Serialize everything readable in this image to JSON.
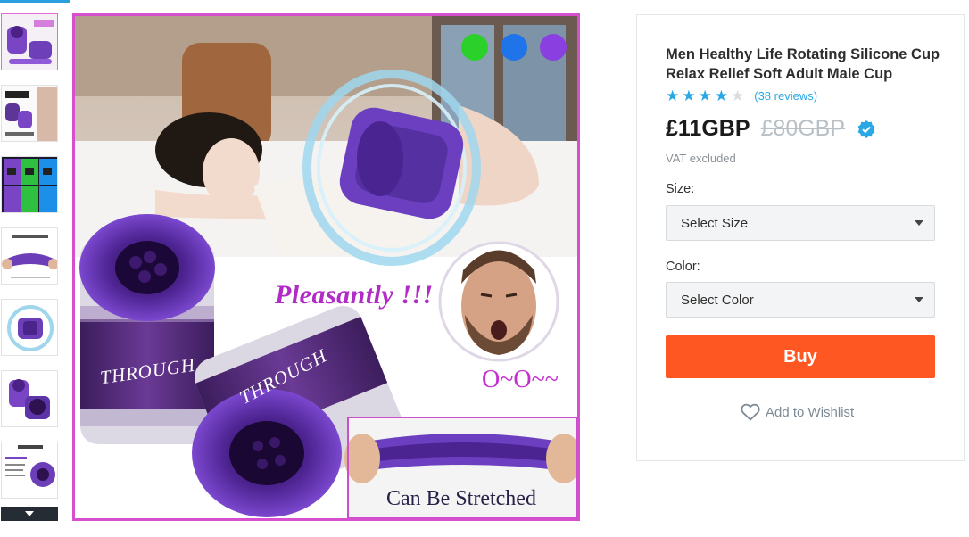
{
  "thumbnails": {
    "items": [
      {
        "name": "thumb-1",
        "caption": "Pleasantly"
      },
      {
        "name": "thumb-2",
        "caption": "RELAX!"
      },
      {
        "name": "thumb-3",
        "caption": ""
      },
      {
        "name": "thumb-4",
        "caption": "High Elastic + Durable"
      },
      {
        "name": "thumb-5",
        "caption": ""
      },
      {
        "name": "thumb-6",
        "caption": ""
      },
      {
        "name": "thumb-7",
        "caption": "2019 NEW"
      }
    ],
    "more_icon": "chevron-down-icon"
  },
  "main_image": {
    "texts": {
      "pleasantly": "Pleasantly !!!",
      "oo": "O~O~~",
      "stretched": "Can Be Stretched",
      "can_text_1": "THROUGH",
      "can_text_2": "THROUGH"
    },
    "color_dots": [
      "#2bd02b",
      "#1e74e8",
      "#8a3fe0"
    ]
  },
  "product": {
    "title": "Men Healthy Life Rotating Silicone Cup Relax Relief Soft Adult Male Cup",
    "rating": 4,
    "reviews_label": "(38 reviews)",
    "price": "£11GBP",
    "old_price": "£80GBP",
    "vat_label": "VAT excluded",
    "size_label": "Size:",
    "size_placeholder": "Select Size",
    "color_label": "Color:",
    "color_placeholder": "Select Color",
    "buy_label": "Buy",
    "wishlist_label": "Add to Wishlist",
    "accent_color": "#ff5722",
    "link_color": "#2aa8e6"
  }
}
